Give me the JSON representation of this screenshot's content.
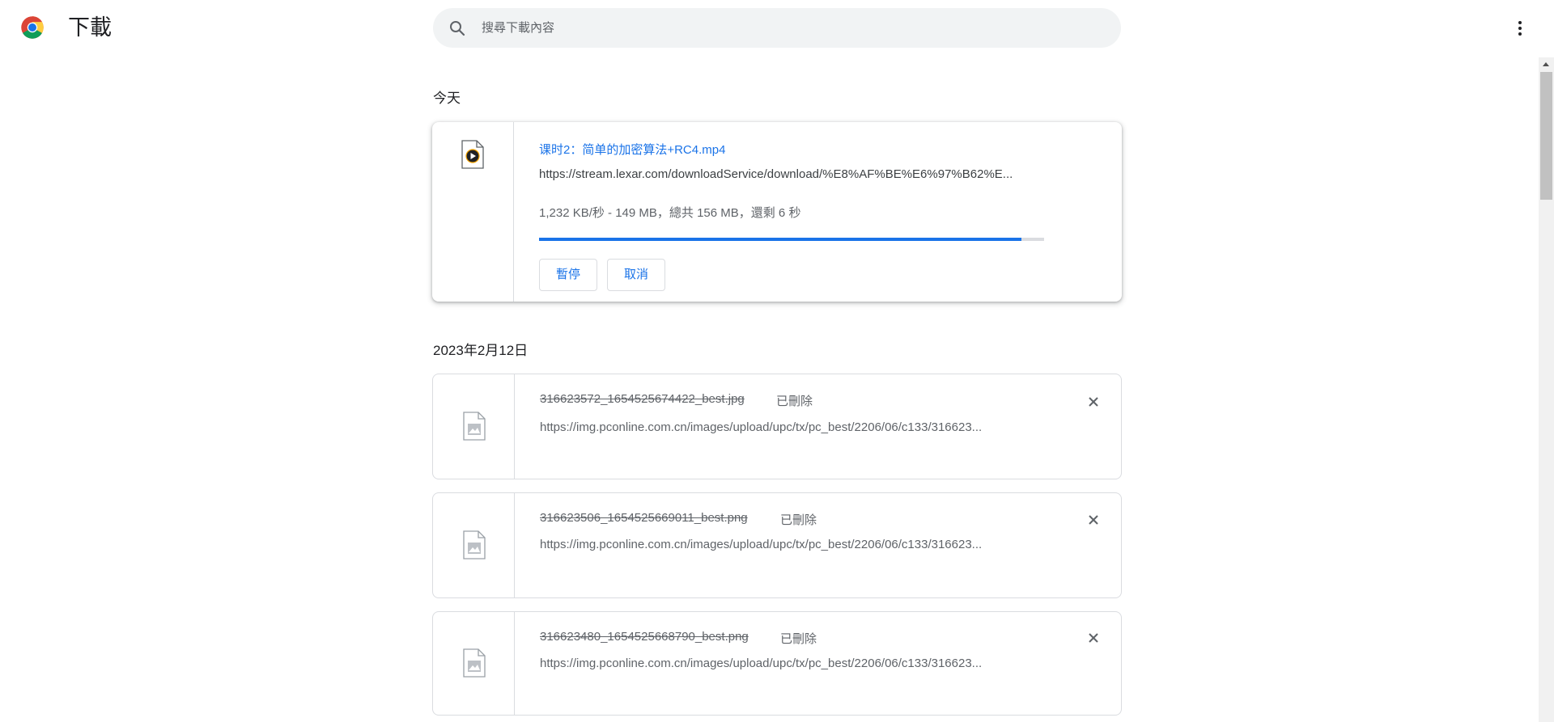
{
  "header": {
    "title": "下載",
    "search_placeholder": "搜尋下載內容"
  },
  "sections": [
    {
      "heading": "今天",
      "items": [
        {
          "file_name": "课时2：简单的加密算法+RC4.mp4",
          "url": "https://stream.lexar.com/downloadService/download/%E8%AF%BE%E6%97%B62%E...",
          "status_text": "1,232 KB/秒 - 149 MB，總共 156 MB，還剩 6 秒",
          "progress": 0.955,
          "pause_label": "暫停",
          "cancel_label": "取消",
          "icon": "video-file-icon"
        }
      ]
    },
    {
      "heading": "2023年2月12日",
      "items": [
        {
          "file_name": "316623572_1654525674422_best.jpg",
          "status_tag": "已刪除",
          "url": "https://img.pconline.com.cn/images/upload/upc/tx/pc_best/2206/06/c133/316623...",
          "icon": "image-file-icon"
        },
        {
          "file_name": "316623506_1654525669011_best.png",
          "status_tag": "已刪除",
          "url": "https://img.pconline.com.cn/images/upload/upc/tx/pc_best/2206/06/c133/316623...",
          "icon": "image-file-icon"
        },
        {
          "file_name": "316623480_1654525668790_best.png",
          "status_tag": "已刪除",
          "url": "https://img.pconline.com.cn/images/upload/upc/tx/pc_best/2206/06/c133/316623...",
          "icon": "image-file-icon"
        }
      ]
    }
  ],
  "colors": {
    "accent": "#1a73e8",
    "text_primary": "#202124",
    "text_secondary": "#5f6368",
    "border": "#dadce0"
  }
}
